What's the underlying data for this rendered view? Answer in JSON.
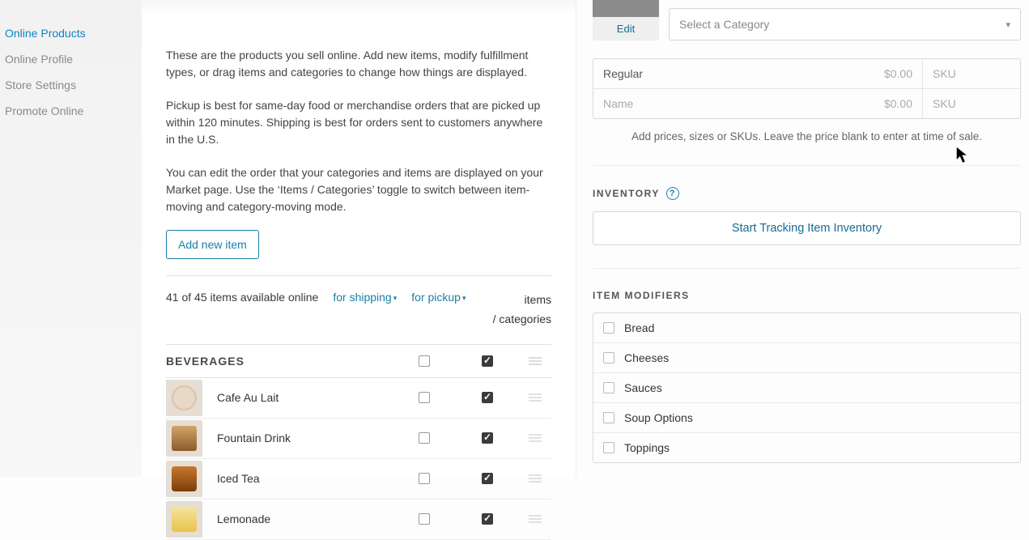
{
  "sidebar": {
    "items": [
      {
        "label": "Online Products",
        "active": true
      },
      {
        "label": "Online Profile",
        "active": false
      },
      {
        "label": "Store Settings",
        "active": false
      },
      {
        "label": "Promote Online",
        "active": false
      }
    ]
  },
  "main": {
    "intro1": "These are the products you sell online. Add new items, modify fulfillment types, or drag items and categories to change how things are displayed.",
    "intro2": "Pickup is best for same-day food or merchandise orders that are picked up within 120 minutes. Shipping is best for orders sent to customers anywhere in the U.S.",
    "intro3": "You can edit the order that your categories and items are displayed on your Market page. Use the ‘Items / Categories’ toggle to switch between item-moving and category-moving mode.",
    "add_button": "Add new item",
    "count_text": "41 of 45 items available online",
    "filter_shipping": "for shipping",
    "filter_pickup": "for pickup",
    "mode_line1": "items",
    "mode_line2": "/ categories",
    "category": "BEVERAGES",
    "items": [
      {
        "name": "Cafe Au Lait",
        "ship": false,
        "pickup": true
      },
      {
        "name": "Fountain Drink",
        "ship": false,
        "pickup": true
      },
      {
        "name": "Iced Tea",
        "ship": false,
        "pickup": true
      },
      {
        "name": "Lemonade",
        "ship": false,
        "pickup": true
      }
    ]
  },
  "right": {
    "edit_label": "Edit",
    "category_placeholder": "Select a Category",
    "price_rows": [
      {
        "name": "Regular",
        "price": "$0.00",
        "sku": "SKU",
        "placeholder": false
      },
      {
        "name": "Name",
        "price": "$0.00",
        "sku": "SKU",
        "placeholder": true
      }
    ],
    "price_hint": "Add prices, sizes or SKUs. Leave the price blank to enter at time of sale.",
    "inventory_title": "INVENTORY",
    "track_button": "Start Tracking Item Inventory",
    "modifiers_title": "ITEM MODIFIERS",
    "modifiers": [
      "Bread",
      "Cheeses",
      "Sauces",
      "Soup Options",
      "Toppings"
    ]
  }
}
